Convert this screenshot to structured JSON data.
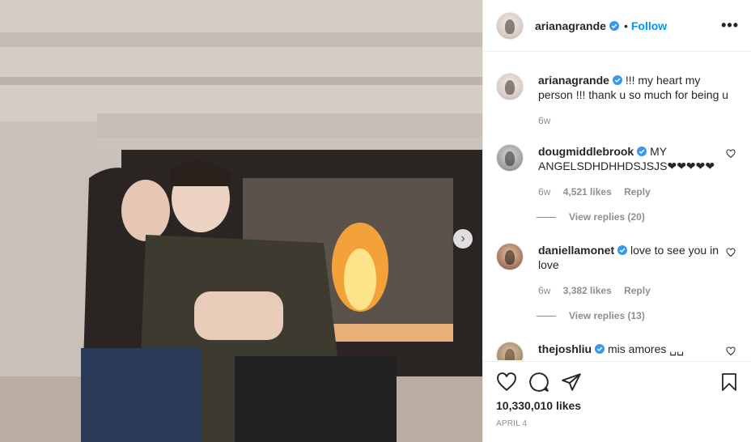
{
  "post": {
    "username": "arianagrande",
    "follow_label": "Follow",
    "dot": "•",
    "more": "•••",
    "likes": "10,330,010 likes",
    "date": "APRIL 4"
  },
  "caption": {
    "username": "arianagrande",
    "text": "!!! my heart my person !!! thank u so much for being u",
    "time": "6w"
  },
  "comments": [
    {
      "username": "dougmiddlebrook",
      "text": "MY ANGELSDHDHHDSJSJS❤❤❤❤❤",
      "time": "6w",
      "likes": "4,521 likes",
      "reply": "Reply",
      "view_replies": "View replies (20)"
    },
    {
      "username": "daniellamonet",
      "text": "love to see you in love",
      "time": "6w",
      "likes": "3,382 likes",
      "reply": "Reply",
      "view_replies": "View replies (13)"
    },
    {
      "username": "thejoshliu",
      "text": "mis amores ␣␣"
    }
  ],
  "colors": {
    "accent": "#0095f6",
    "verified": "#3897f0",
    "muted": "#8e8e8e"
  },
  "icons": {
    "verified": "verified-badge-icon",
    "next": "chevron-right-icon",
    "like": "heart-icon",
    "comment": "comment-icon",
    "share": "paper-plane-icon",
    "save": "bookmark-icon"
  }
}
